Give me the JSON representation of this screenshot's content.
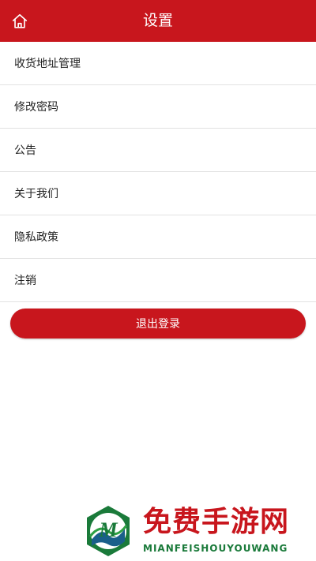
{
  "header": {
    "title": "设置",
    "home_icon": "home-icon"
  },
  "menu": {
    "items": [
      {
        "label": "收货地址管理"
      },
      {
        "label": "修改密码"
      },
      {
        "label": "公告"
      },
      {
        "label": "关于我们"
      },
      {
        "label": "隐私政策"
      },
      {
        "label": "注销"
      }
    ]
  },
  "logout": {
    "label": "退出登录"
  },
  "watermark": {
    "title": "免费手游网",
    "subtitle": "MIANFEISHOUYOUWANG",
    "logo_letter": "M"
  },
  "colors": {
    "brand_red": "#c8161d",
    "watermark_green": "#1a7a3a"
  }
}
